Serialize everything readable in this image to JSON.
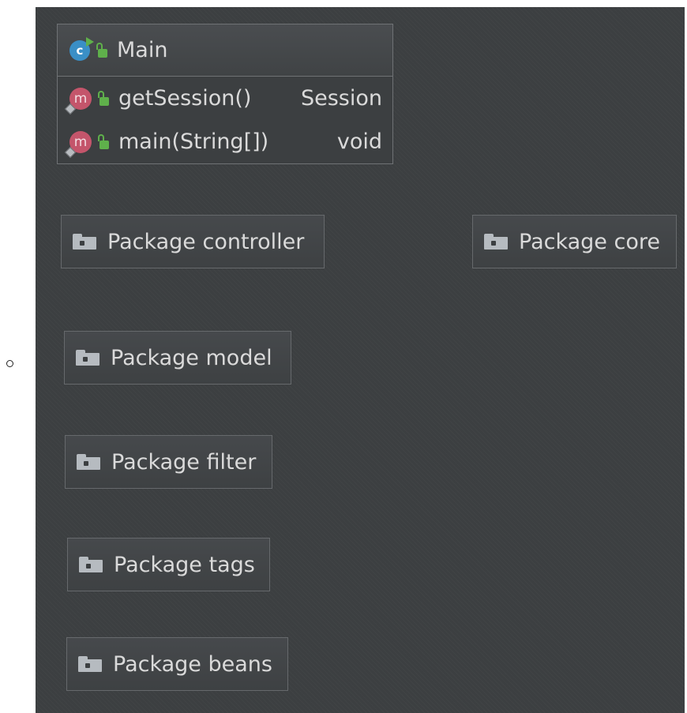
{
  "class": {
    "name": "Main",
    "icon": "class-icon",
    "methods": [
      {
        "name": "getSession()",
        "type": "Session",
        "icon_letter": "m"
      },
      {
        "name": "main(String[])",
        "type": "void",
        "icon_letter": "m"
      }
    ],
    "class_icon_letter": "c"
  },
  "packages": [
    {
      "label": "Package controller"
    },
    {
      "label": "Package core"
    },
    {
      "label": "Package model"
    },
    {
      "label": "Package filter"
    },
    {
      "label": "Package tags"
    },
    {
      "label": "Package beans"
    }
  ],
  "colors": {
    "background": "#3c3f41",
    "text": "#dadada",
    "class_icon": "#3a8fc6",
    "method_icon": "#c4556b",
    "public_lock": "#5fb04b",
    "folder": "#b6bbc0"
  }
}
